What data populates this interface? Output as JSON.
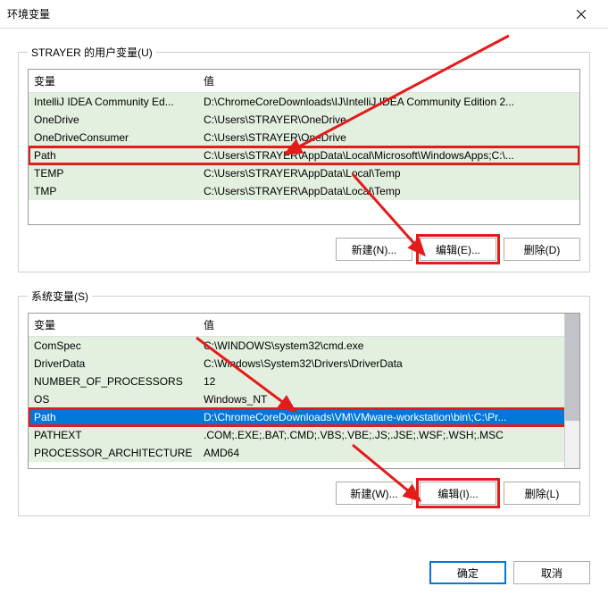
{
  "window": {
    "title": "环境变量"
  },
  "user_vars": {
    "legend": "STRAYER 的用户变量(U)",
    "columns": {
      "name": "变量",
      "value": "值"
    },
    "rows": [
      {
        "name": "IntelliJ IDEA Community Ed...",
        "value": "D:\\ChromeCoreDownloads\\IJ\\IntelliJ IDEA Community Edition 2..."
      },
      {
        "name": "OneDrive",
        "value": "C:\\Users\\STRAYER\\OneDrive"
      },
      {
        "name": "OneDriveConsumer",
        "value": "C:\\Users\\STRAYER\\OneDrive"
      },
      {
        "name": "Path",
        "value": "C:\\Users\\STRAYER\\AppData\\Local\\Microsoft\\WindowsApps;C:\\..."
      },
      {
        "name": "TEMP",
        "value": "C:\\Users\\STRAYER\\AppData\\Local\\Temp"
      },
      {
        "name": "TMP",
        "value": "C:\\Users\\STRAYER\\AppData\\Local\\Temp"
      }
    ],
    "buttons": {
      "new": "新建(N)...",
      "edit": "编辑(E)...",
      "delete": "删除(D)"
    }
  },
  "system_vars": {
    "legend": "系统变量(S)",
    "columns": {
      "name": "变量",
      "value": "值"
    },
    "rows": [
      {
        "name": "ComSpec",
        "value": "C:\\WINDOWS\\system32\\cmd.exe"
      },
      {
        "name": "DriverData",
        "value": "C:\\Windows\\System32\\Drivers\\DriverData"
      },
      {
        "name": "NUMBER_OF_PROCESSORS",
        "value": "12"
      },
      {
        "name": "OS",
        "value": "Windows_NT"
      },
      {
        "name": "Path",
        "value": "D:\\ChromeCoreDownloads\\VM\\VMware-workstation\\bin\\;C:\\Pr..."
      },
      {
        "name": "PATHEXT",
        "value": ".COM;.EXE;.BAT;.CMD;.VBS;.VBE;.JS;.JSE;.WSF;.WSH;.MSC"
      },
      {
        "name": "PROCESSOR_ARCHITECTURE",
        "value": "AMD64"
      }
    ],
    "buttons": {
      "new": "新建(W)...",
      "edit": "编辑(I)...",
      "delete": "删除(L)"
    }
  },
  "dialog_buttons": {
    "ok": "确定",
    "cancel": "取消"
  }
}
